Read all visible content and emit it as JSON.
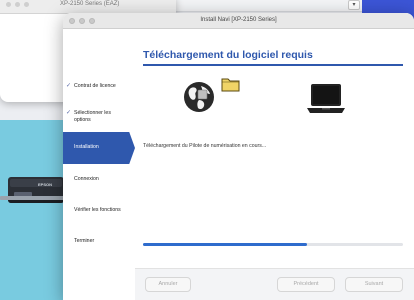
{
  "back_window": {
    "title": "XP-2150 Series (EAZ)"
  },
  "desktop": {
    "printer_brand": "EPSON"
  },
  "window": {
    "title": "Install Navi [XP-2150 Series]"
  },
  "sidebar": {
    "items": [
      {
        "label": "Contrat de licence",
        "state": "done"
      },
      {
        "label": "Sélectionner les options",
        "state": "done"
      },
      {
        "label": "Installation",
        "state": "active"
      },
      {
        "label": "Connexion",
        "state": "pending"
      },
      {
        "label": "Vérifier les fonctions",
        "state": "pending"
      },
      {
        "label": "Terminer",
        "state": "pending"
      }
    ]
  },
  "main": {
    "heading": "Téléchargement du logiciel requis",
    "status": "Téléchargement du Pilote de numérisation en cours...",
    "progress_fraction": 0.63
  },
  "buttons": {
    "cancel": "Annuler",
    "previous": "Précédent",
    "next": "Suivant"
  },
  "icons": {
    "globe": "globe-icon",
    "folder": "folder-icon",
    "laptop": "laptop-icon",
    "check": "checkmark-icon"
  },
  "colors": {
    "accent": "#2f58ad",
    "progress": "#2f6ccd",
    "folder": "#f0d466"
  }
}
